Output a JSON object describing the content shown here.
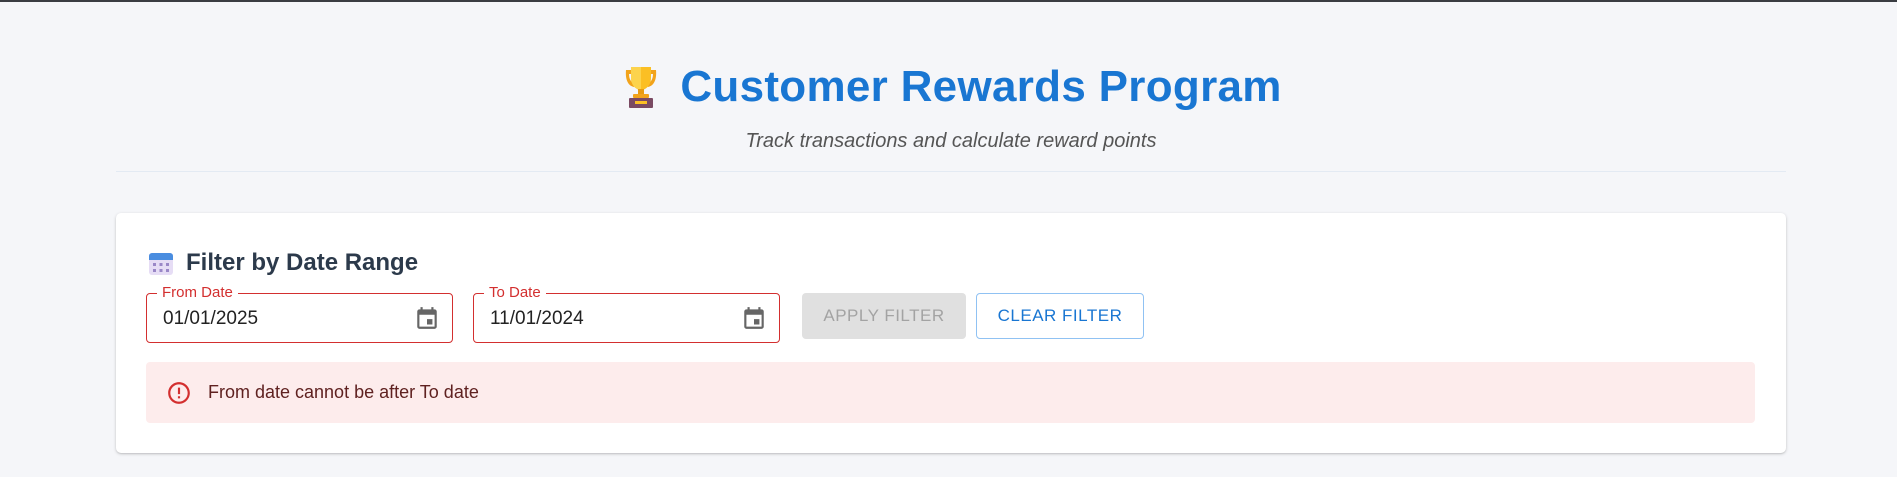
{
  "header": {
    "trophy_icon": "trophy-icon",
    "title": "Customer Rewards Program",
    "subtitle": "Track transactions and calculate reward points"
  },
  "filter": {
    "calendar_icon": "calendar-icon",
    "heading": "Filter by Date Range",
    "from_label": "From Date",
    "from_value": "01/01/2025",
    "to_label": "To Date",
    "to_value": "11/01/2024",
    "apply_label": "APPLY FILTER",
    "apply_disabled": true,
    "clear_label": "CLEAR FILTER",
    "error_message": "From date cannot be after To date"
  },
  "colors": {
    "accent": "#1976d2",
    "error": "#d32f2f",
    "error_bg": "#fdecec",
    "page_bg": "#f5f6f9"
  }
}
